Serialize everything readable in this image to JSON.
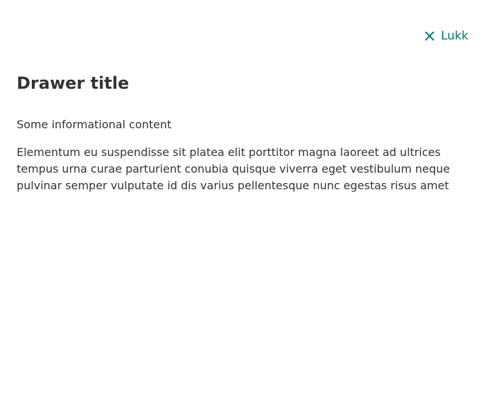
{
  "drawer": {
    "close_label": "Lukk",
    "title": "Drawer title",
    "paragraphs": [
      "Some informational content",
      "Elementum eu suspendisse sit platea elit porttitor magna laoreet ad ultrices tempus urna curae parturient conubia quisque viverra eget vestibulum neque pulvinar semper vulputate id dis varius pellentesque nunc egestas risus amet"
    ]
  },
  "icons": {
    "close": "close-icon"
  },
  "colors": {
    "accent": "#00776f",
    "text": "#333333",
    "background": "#ffffff"
  }
}
